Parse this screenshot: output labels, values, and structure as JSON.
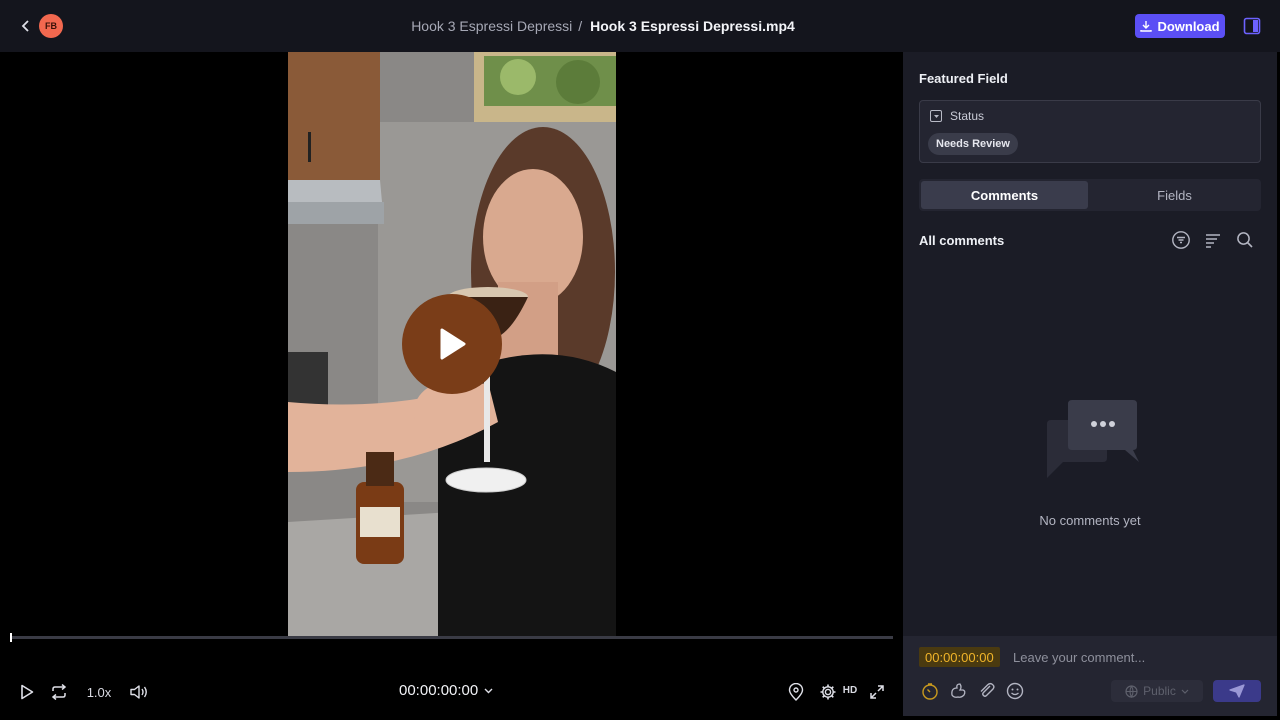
{
  "header": {
    "avatar_initials": "FB",
    "breadcrumb_parent": "Hook 3 Espressi Depressi",
    "breadcrumb_separator": "/",
    "file_name": "Hook 3 Espressi Depressi.mp4",
    "download_label": "Download",
    "accent_color": "#5b4ff5"
  },
  "player": {
    "progress": 0,
    "speed": "1.0x",
    "timecode": "00:00:00:00",
    "quality": "HD",
    "play_button_color": "#7a3d18"
  },
  "panel": {
    "featured_title": "Featured Field",
    "status_label": "Status",
    "status_value": "Needs Review",
    "tabs": [
      {
        "label": "Comments",
        "active": true
      },
      {
        "label": "Fields",
        "active": false
      }
    ],
    "comments_heading": "All comments",
    "empty_text": "No comments yet"
  },
  "composer": {
    "timecode": "00:00:00:00",
    "placeholder": "Leave your comment...",
    "visibility": "Public"
  }
}
